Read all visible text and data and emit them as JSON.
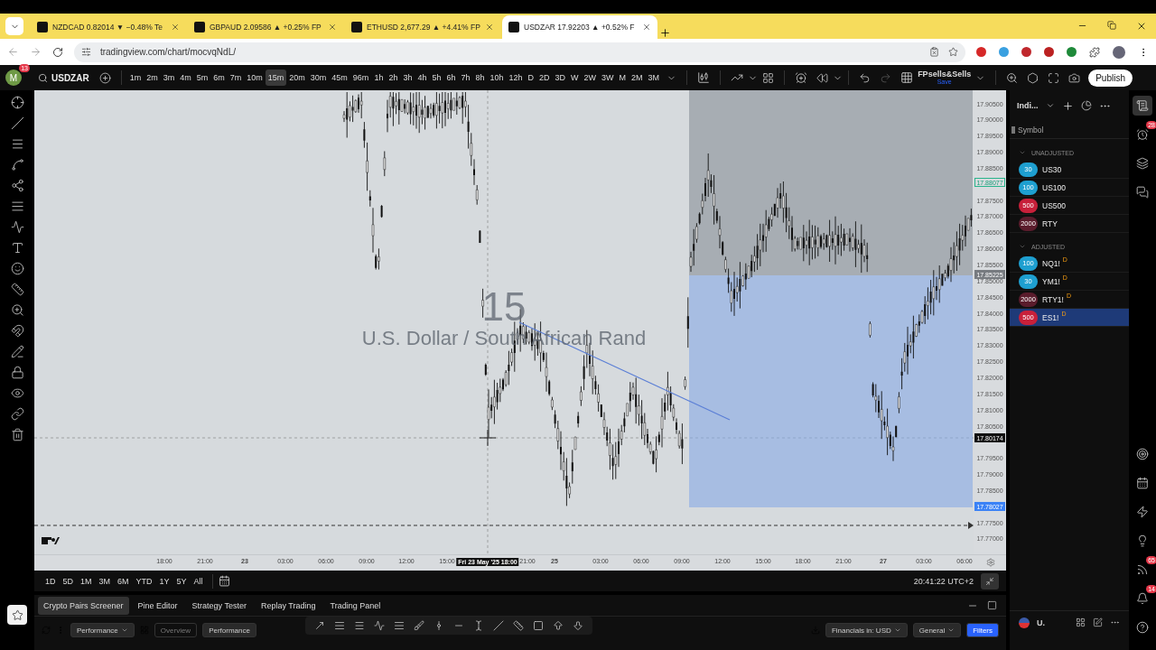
{
  "browser": {
    "tabs": [
      {
        "title": "NZDCAD 0.82014 ▼ −0.48% Te",
        "selected": false
      },
      {
        "title": "GBPAUD 2.09586 ▲ +0.25% FP",
        "selected": false
      },
      {
        "title": "ETHUSD 2,677.29 ▲ +4.41% FP",
        "selected": false
      },
      {
        "title": "USDZAR 17.92203 ▲ +0.52% F",
        "selected": true
      }
    ],
    "url": "tradingview.com/chart/mocvqNdL/"
  },
  "toolbar": {
    "avatar": "M",
    "avatar_badge": "13",
    "symbol": "USDZAR",
    "intervals": [
      {
        "label": "1m",
        "selected": false
      },
      {
        "label": "2m",
        "selected": false
      },
      {
        "label": "3m",
        "selected": false
      },
      {
        "label": "4m",
        "selected": false
      },
      {
        "label": "5m",
        "selected": false
      },
      {
        "label": "6m",
        "selected": false
      },
      {
        "label": "7m",
        "selected": false
      },
      {
        "label": "10m",
        "selected": false
      },
      {
        "label": "15m",
        "selected": true
      },
      {
        "label": "20m",
        "selected": false
      },
      {
        "label": "30m",
        "selected": false
      },
      {
        "label": "45m",
        "selected": false
      },
      {
        "label": "96m",
        "selected": false
      },
      {
        "label": "1h",
        "selected": false
      },
      {
        "label": "2h",
        "selected": false
      },
      {
        "label": "3h",
        "selected": false
      },
      {
        "label": "4h",
        "selected": false
      },
      {
        "label": "5h",
        "selected": false
      },
      {
        "label": "6h",
        "selected": false
      },
      {
        "label": "7h",
        "selected": false
      },
      {
        "label": "8h",
        "selected": false
      },
      {
        "label": "10h",
        "selected": false
      },
      {
        "label": "12h",
        "selected": false
      },
      {
        "label": "D",
        "selected": false
      },
      {
        "label": "2D",
        "selected": false
      },
      {
        "label": "3D",
        "selected": false
      },
      {
        "label": "W",
        "selected": false
      },
      {
        "label": "2W",
        "selected": false
      },
      {
        "label": "3W",
        "selected": false
      },
      {
        "label": "M",
        "selected": false
      },
      {
        "label": "2M",
        "selected": false
      },
      {
        "label": "3M",
        "selected": false
      }
    ],
    "layout_name": "FPsells&Sells",
    "save_label": "Save",
    "publish": "Publish"
  },
  "chart": {
    "watermark_interval": "15",
    "watermark_name": "U.S. Dollar / South African Rand",
    "price_labels": [
      "17.90500",
      "17.90000",
      "17.89500",
      "17.89000",
      "17.88500",
      "17.87500",
      "17.87000",
      "17.86500",
      "17.86000",
      "17.85500",
      "17.85000",
      "17.84500",
      "17.84000",
      "17.83500",
      "17.83000",
      "17.82500",
      "17.82000",
      "17.81500",
      "17.81000",
      "17.80500",
      "17.79500",
      "17.79000",
      "17.78500",
      "17.77500",
      "17.77000"
    ],
    "price_markers": [
      {
        "label": "17.88077",
        "kind": "outline"
      },
      {
        "label": "17.85225",
        "kind": "grey"
      },
      {
        "label": "17.80174",
        "kind": "cursor"
      },
      {
        "label": "17.78027",
        "kind": "blue"
      }
    ],
    "time_labels": [
      {
        "label": "18:00",
        "kind": "time"
      },
      {
        "label": "21:00",
        "kind": "time"
      },
      {
        "label": "23",
        "kind": "day"
      },
      {
        "label": "03:00",
        "kind": "time"
      },
      {
        "label": "06:00",
        "kind": "time"
      },
      {
        "label": "09:00",
        "kind": "time"
      },
      {
        "label": "12:00",
        "kind": "time"
      },
      {
        "label": "15:00",
        "kind": "time"
      },
      {
        "label": "Fri 23 May '25 18:00",
        "kind": "cursor"
      },
      {
        "label": "21:00",
        "kind": "time"
      },
      {
        "label": "25",
        "kind": "day"
      },
      {
        "label": "03:00",
        "kind": "time"
      },
      {
        "label": "06:00",
        "kind": "time"
      },
      {
        "label": "09:00",
        "kind": "time"
      },
      {
        "label": "12:00",
        "kind": "time"
      },
      {
        "label": "15:00",
        "kind": "time"
      },
      {
        "label": "18:00",
        "kind": "time"
      },
      {
        "label": "21:00",
        "kind": "time"
      },
      {
        "label": "27",
        "kind": "day"
      },
      {
        "label": "03:00",
        "kind": "time"
      },
      {
        "label": "06:00",
        "kind": "time"
      }
    ]
  },
  "range_bar": {
    "ranges": [
      "1D",
      "5D",
      "1M",
      "3M",
      "6M",
      "YTD",
      "1Y",
      "5Y",
      "All"
    ],
    "clock": "20:41:22 UTC+2"
  },
  "bottom_panel": {
    "tabs": [
      {
        "label": "Crypto Pairs Screener",
        "selected": true
      },
      {
        "label": "Pine Editor",
        "selected": false
      },
      {
        "label": "Strategy Tester",
        "selected": false
      },
      {
        "label": "Replay Trading",
        "selected": false
      },
      {
        "label": "Trading Panel",
        "selected": false
      }
    ],
    "screener": {
      "preset": "Performance",
      "views": [
        {
          "label": "Overview",
          "selected": false
        },
        {
          "label": "Performance",
          "selected": true
        }
      ],
      "currency": "Financials in: USD",
      "group": "General",
      "filters": "Filters"
    }
  },
  "watchlist": {
    "title": "Indi...",
    "column": "Symbol",
    "sections": [
      {
        "title": "UNADJUSTED",
        "expanded": true,
        "items": [
          {
            "symbol": "US30",
            "logo": "30",
            "color": "#1e9fd0",
            "selected": false
          },
          {
            "symbol": "US100",
            "logo": "100",
            "color": "#1e9fd0",
            "selected": false
          },
          {
            "symbol": "US500",
            "logo": "500",
            "color": "#c8203a",
            "selected": false
          },
          {
            "symbol": "RTY",
            "logo": "2000",
            "color": "#5a1c2c",
            "selected": false
          }
        ]
      },
      {
        "title": "ADJUSTED",
        "expanded": true,
        "items": [
          {
            "symbol": "NQ1!",
            "suffix": "D",
            "logo": "100",
            "color": "#1e9fd0",
            "selected": false
          },
          {
            "symbol": "YM1!",
            "suffix": "D",
            "logo": "30",
            "color": "#1e9fd0",
            "selected": false
          },
          {
            "symbol": "RTY1!",
            "suffix": "D",
            "logo": "2000",
            "color": "#5a1c2c",
            "selected": false
          },
          {
            "symbol": "ES1!",
            "suffix": "D",
            "logo": "500",
            "color": "#c8203a",
            "selected": true
          }
        ]
      }
    ],
    "footer": "U."
  },
  "side_badges": {
    "alerts": "28",
    "news": "65",
    "notifications": "14"
  }
}
